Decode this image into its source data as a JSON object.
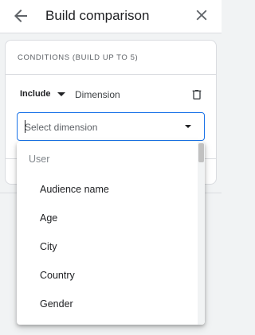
{
  "header": {
    "title": "Build comparison",
    "back_icon": "arrow-back-icon",
    "close_icon": "close-icon"
  },
  "conditions": {
    "title": "CONDITIONS (BUILD UP TO 5)",
    "include_label": "Include",
    "dimension_label": "Dimension",
    "delete_icon": "trash-icon",
    "select_placeholder": "Select dimension"
  },
  "dropdown": {
    "group_label": "User",
    "options": [
      "Audience name",
      "Age",
      "City",
      "Country",
      "Gender"
    ]
  },
  "colors": {
    "accent": "#1a73e8",
    "text": "#202124",
    "muted": "#5f6368"
  }
}
